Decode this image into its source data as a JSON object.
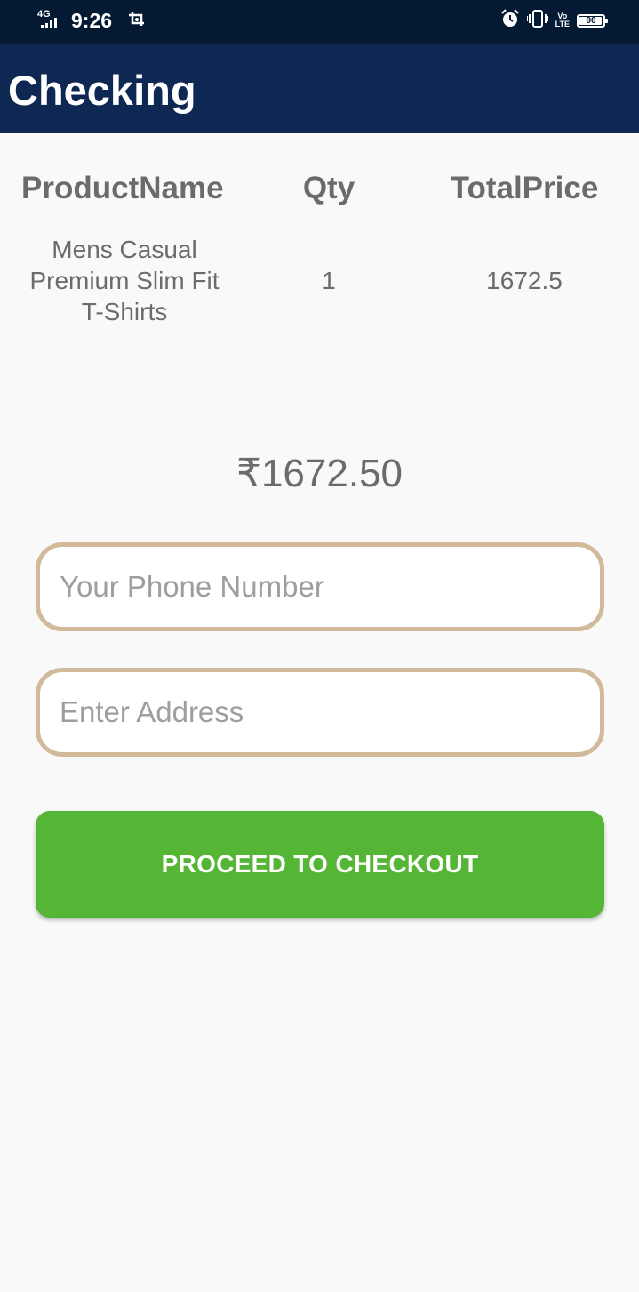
{
  "status_bar": {
    "network": "4G",
    "time": "9:26",
    "volte": "Vo LTE",
    "battery": 96,
    "icons": [
      "signal-icon",
      "screenshot-icon",
      "alarm-icon",
      "vibrate-icon",
      "volte-icon",
      "battery-icon"
    ]
  },
  "app_bar": {
    "title": "Checking",
    "background": "#0e2853"
  },
  "table": {
    "headers": [
      "ProductName",
      "Qty",
      "TotalPrice"
    ],
    "rows": [
      [
        "Mens Casual Premium Slim Fit T-Shirts",
        "1",
        "1672.5"
      ]
    ]
  },
  "total": "₹1672.50",
  "form": {
    "phone_placeholder": "Your Phone Number",
    "phone_value": "",
    "address_placeholder": "Enter Address",
    "address_value": "",
    "field_border_color": "#d2b99a"
  },
  "checkout_button": {
    "label": "PROCEED TO CHECKOUT",
    "color": "#55b535"
  }
}
